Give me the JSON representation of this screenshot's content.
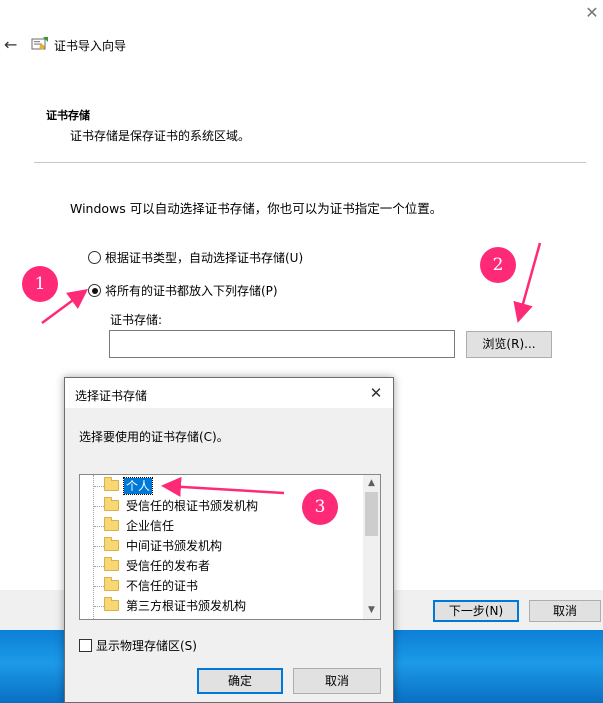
{
  "window": {
    "close_glyph": "✕",
    "back_glyph": "←",
    "title": "证书导入向导"
  },
  "section": {
    "title": "证书存储",
    "description": "证书存储是保存证书的系统区域。"
  },
  "note": "Windows 可以自动选择证书存储，你也可以为证书指定一个位置。",
  "options": {
    "auto_label": "根据证书类型，自动选择证书存储(U)",
    "auto_selected": false,
    "all_label": "将所有的证书都放入下列存储(P)",
    "all_selected": true
  },
  "store": {
    "label": "证书存储:",
    "value": "",
    "browse_label": "浏览(R)..."
  },
  "footer": {
    "next_label": "下一步(N)",
    "cancel_label": "取消"
  },
  "dialog": {
    "title": "选择证书存储",
    "close_glyph": "✕",
    "prompt": "选择要使用的证书存储(C)。",
    "stores": [
      {
        "label": "个人",
        "selected": true
      },
      {
        "label": "受信任的根证书颁发机构",
        "selected": false
      },
      {
        "label": "企业信任",
        "selected": false
      },
      {
        "label": "中间证书颁发机构",
        "selected": false
      },
      {
        "label": "受信任的发布者",
        "selected": false
      },
      {
        "label": "不信任的证书",
        "selected": false
      },
      {
        "label": "第三方根证书颁发机构",
        "selected": false
      }
    ],
    "scroll_up_glyph": "▲",
    "scroll_down_glyph": "▼",
    "show_physical_label": "显示物理存储区(S)",
    "show_physical_checked": false,
    "ok_label": "确定",
    "cancel_label": "取消"
  },
  "annotations": {
    "badge_1": "1",
    "badge_2": "2",
    "badge_3": "3",
    "color": "#ff2a77"
  },
  "colors": {
    "accent": "#0078d7",
    "selection": "#0078d7",
    "desktop": "#1c9ae8"
  }
}
